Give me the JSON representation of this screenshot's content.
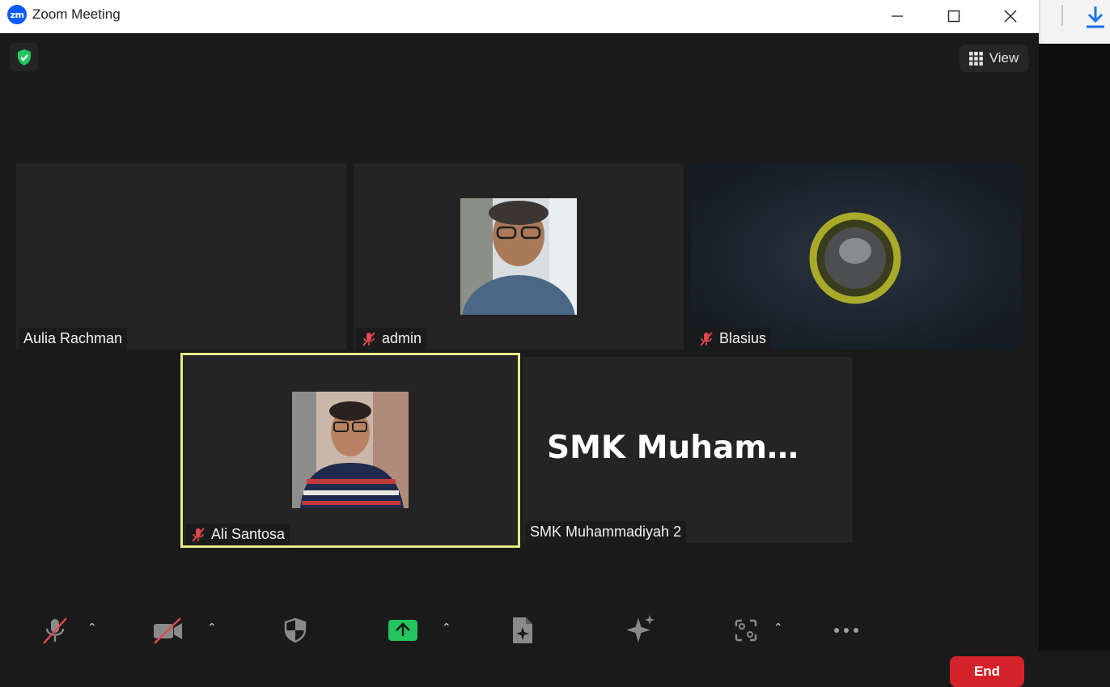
{
  "window": {
    "title": "Zoom Meeting",
    "logo_text": "zm"
  },
  "header": {
    "view_label": "View"
  },
  "participants": [
    {
      "name": "Aulia Rachman",
      "muted": false
    },
    {
      "name": "admin",
      "muted": true
    },
    {
      "name": "Blasius",
      "muted": true
    },
    {
      "name": "Ali Santosa",
      "muted": true,
      "active_speaker": true
    },
    {
      "name": "SMK Muhammadiyah 2",
      "muted": false,
      "display_text": "SMK  Muhamma..."
    }
  ],
  "toolbar": {
    "end_label": "End"
  },
  "colors": {
    "accent_blue": "#0b5cff",
    "end_red": "#d3222a",
    "share_green": "#22c55e",
    "active_border": "#e7ea83"
  }
}
